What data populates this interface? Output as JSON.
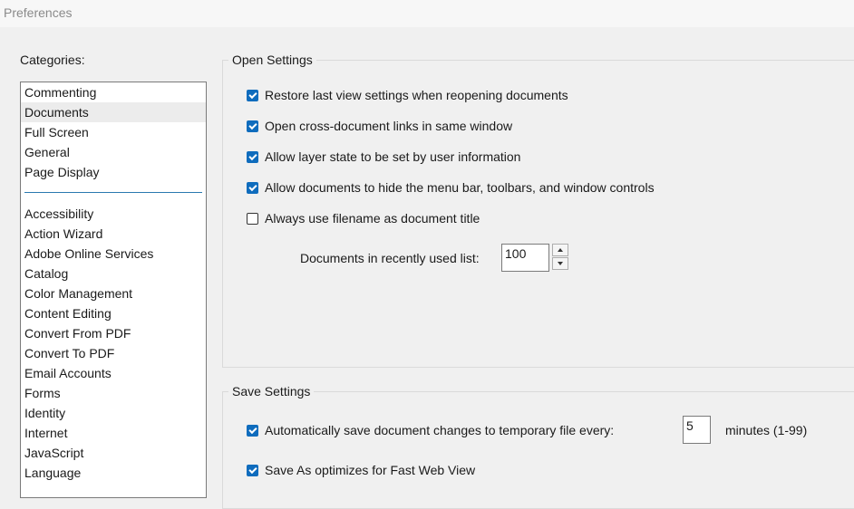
{
  "window": {
    "title": "Preferences"
  },
  "categories": {
    "label": "Categories:",
    "top_items": [
      "Commenting",
      "Documents",
      "Full Screen",
      "General",
      "Page Display"
    ],
    "selected": "Documents",
    "items": [
      "Accessibility",
      "Action Wizard",
      "Adobe Online Services",
      "Catalog",
      "Color Management",
      "Content Editing",
      "Convert From PDF",
      "Convert To PDF",
      "Email Accounts",
      "Forms",
      "Identity",
      "Internet",
      "JavaScript",
      "Language"
    ]
  },
  "open_settings": {
    "legend": "Open Settings",
    "options": [
      {
        "label": "Restore last view settings when reopening documents",
        "checked": true
      },
      {
        "label": "Open cross-document links in same window",
        "checked": true
      },
      {
        "label": "Allow layer state to be set by user information",
        "checked": true
      },
      {
        "label": "Allow documents to hide the menu bar, toolbars, and window controls",
        "checked": true
      },
      {
        "label": "Always use filename as document title",
        "checked": false
      }
    ],
    "recent_label": "Documents in recently used list:",
    "recent_value": "100"
  },
  "save_settings": {
    "legend": "Save Settings",
    "autosave_label": "Automatically save document changes to temporary file every:",
    "autosave_checked": true,
    "autosave_value": "5",
    "autosave_suffix": "minutes (1-99)",
    "fastweb_label": "Save As optimizes for Fast Web View",
    "fastweb_checked": true
  },
  "colors": {
    "accent": "#0f6cbd",
    "separator": "#2a7ab0",
    "selected_row": "#ececec"
  }
}
